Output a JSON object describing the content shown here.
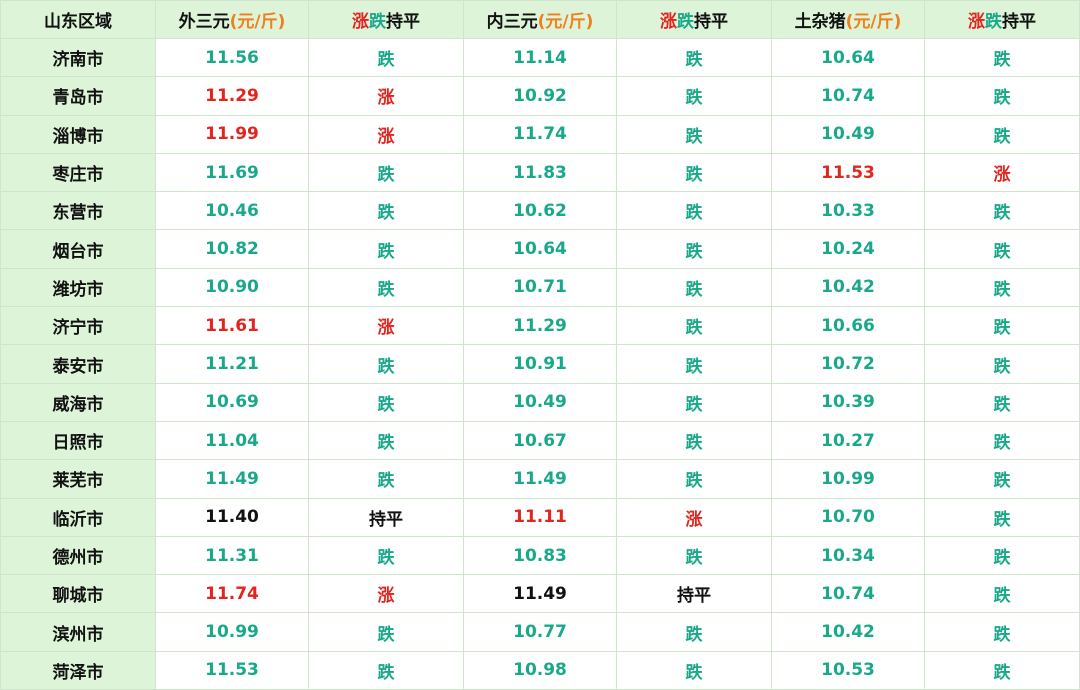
{
  "header": {
    "region": "山东区域",
    "col_outer": {
      "label": "外三元",
      "unit": "(元/斤)"
    },
    "col_inner": {
      "label": "内三元",
      "unit": "(元/斤)"
    },
    "col_local": {
      "label": "土杂猪",
      "unit": "(元/斤)"
    },
    "trend": {
      "up": "涨",
      "down": "跌",
      "flat": "持平"
    }
  },
  "colors": {
    "up": "#e0261f",
    "down": "#1aa88a",
    "flat": "#111111",
    "unit": "#f07f1d",
    "region_bg": "#ddf4d8"
  },
  "rows": [
    {
      "city": "济南市",
      "outer": "11.56",
      "outer_trend": "跌",
      "inner": "11.14",
      "inner_trend": "跌",
      "local": "10.64",
      "local_trend": "跌"
    },
    {
      "city": "青岛市",
      "outer": "11.29",
      "outer_trend": "涨",
      "inner": "10.92",
      "inner_trend": "跌",
      "local": "10.74",
      "local_trend": "跌"
    },
    {
      "city": "淄博市",
      "outer": "11.99",
      "outer_trend": "涨",
      "inner": "11.74",
      "inner_trend": "跌",
      "local": "10.49",
      "local_trend": "跌"
    },
    {
      "city": "枣庄市",
      "outer": "11.69",
      "outer_trend": "跌",
      "inner": "11.83",
      "inner_trend": "跌",
      "local": "11.53",
      "local_trend": "涨"
    },
    {
      "city": "东营市",
      "outer": "10.46",
      "outer_trend": "跌",
      "inner": "10.62",
      "inner_trend": "跌",
      "local": "10.33",
      "local_trend": "跌"
    },
    {
      "city": "烟台市",
      "outer": "10.82",
      "outer_trend": "跌",
      "inner": "10.64",
      "inner_trend": "跌",
      "local": "10.24",
      "local_trend": "跌"
    },
    {
      "city": "潍坊市",
      "outer": "10.90",
      "outer_trend": "跌",
      "inner": "10.71",
      "inner_trend": "跌",
      "local": "10.42",
      "local_trend": "跌"
    },
    {
      "city": "济宁市",
      "outer": "11.61",
      "outer_trend": "涨",
      "inner": "11.29",
      "inner_trend": "跌",
      "local": "10.66",
      "local_trend": "跌"
    },
    {
      "city": "泰安市",
      "outer": "11.21",
      "outer_trend": "跌",
      "inner": "10.91",
      "inner_trend": "跌",
      "local": "10.72",
      "local_trend": "跌"
    },
    {
      "city": "威海市",
      "outer": "10.69",
      "outer_trend": "跌",
      "inner": "10.49",
      "inner_trend": "跌",
      "local": "10.39",
      "local_trend": "跌"
    },
    {
      "city": "日照市",
      "outer": "11.04",
      "outer_trend": "跌",
      "inner": "10.67",
      "inner_trend": "跌",
      "local": "10.27",
      "local_trend": "跌"
    },
    {
      "city": "莱芜市",
      "outer": "11.49",
      "outer_trend": "跌",
      "inner": "11.49",
      "inner_trend": "跌",
      "local": "10.99",
      "local_trend": "跌"
    },
    {
      "city": "临沂市",
      "outer": "11.40",
      "outer_trend": "持平",
      "inner": "11.11",
      "inner_trend": "涨",
      "local": "10.70",
      "local_trend": "跌"
    },
    {
      "city": "德州市",
      "outer": "11.31",
      "outer_trend": "跌",
      "inner": "10.83",
      "inner_trend": "跌",
      "local": "10.34",
      "local_trend": "跌"
    },
    {
      "city": "聊城市",
      "outer": "11.74",
      "outer_trend": "涨",
      "inner": "11.49",
      "inner_trend": "持平",
      "local": "10.74",
      "local_trend": "跌"
    },
    {
      "city": "滨州市",
      "outer": "10.99",
      "outer_trend": "跌",
      "inner": "10.77",
      "inner_trend": "跌",
      "local": "10.42",
      "local_trend": "跌"
    },
    {
      "city": "菏泽市",
      "outer": "11.53",
      "outer_trend": "跌",
      "inner": "10.98",
      "inner_trend": "跌",
      "local": "10.53",
      "local_trend": "跌"
    }
  ]
}
